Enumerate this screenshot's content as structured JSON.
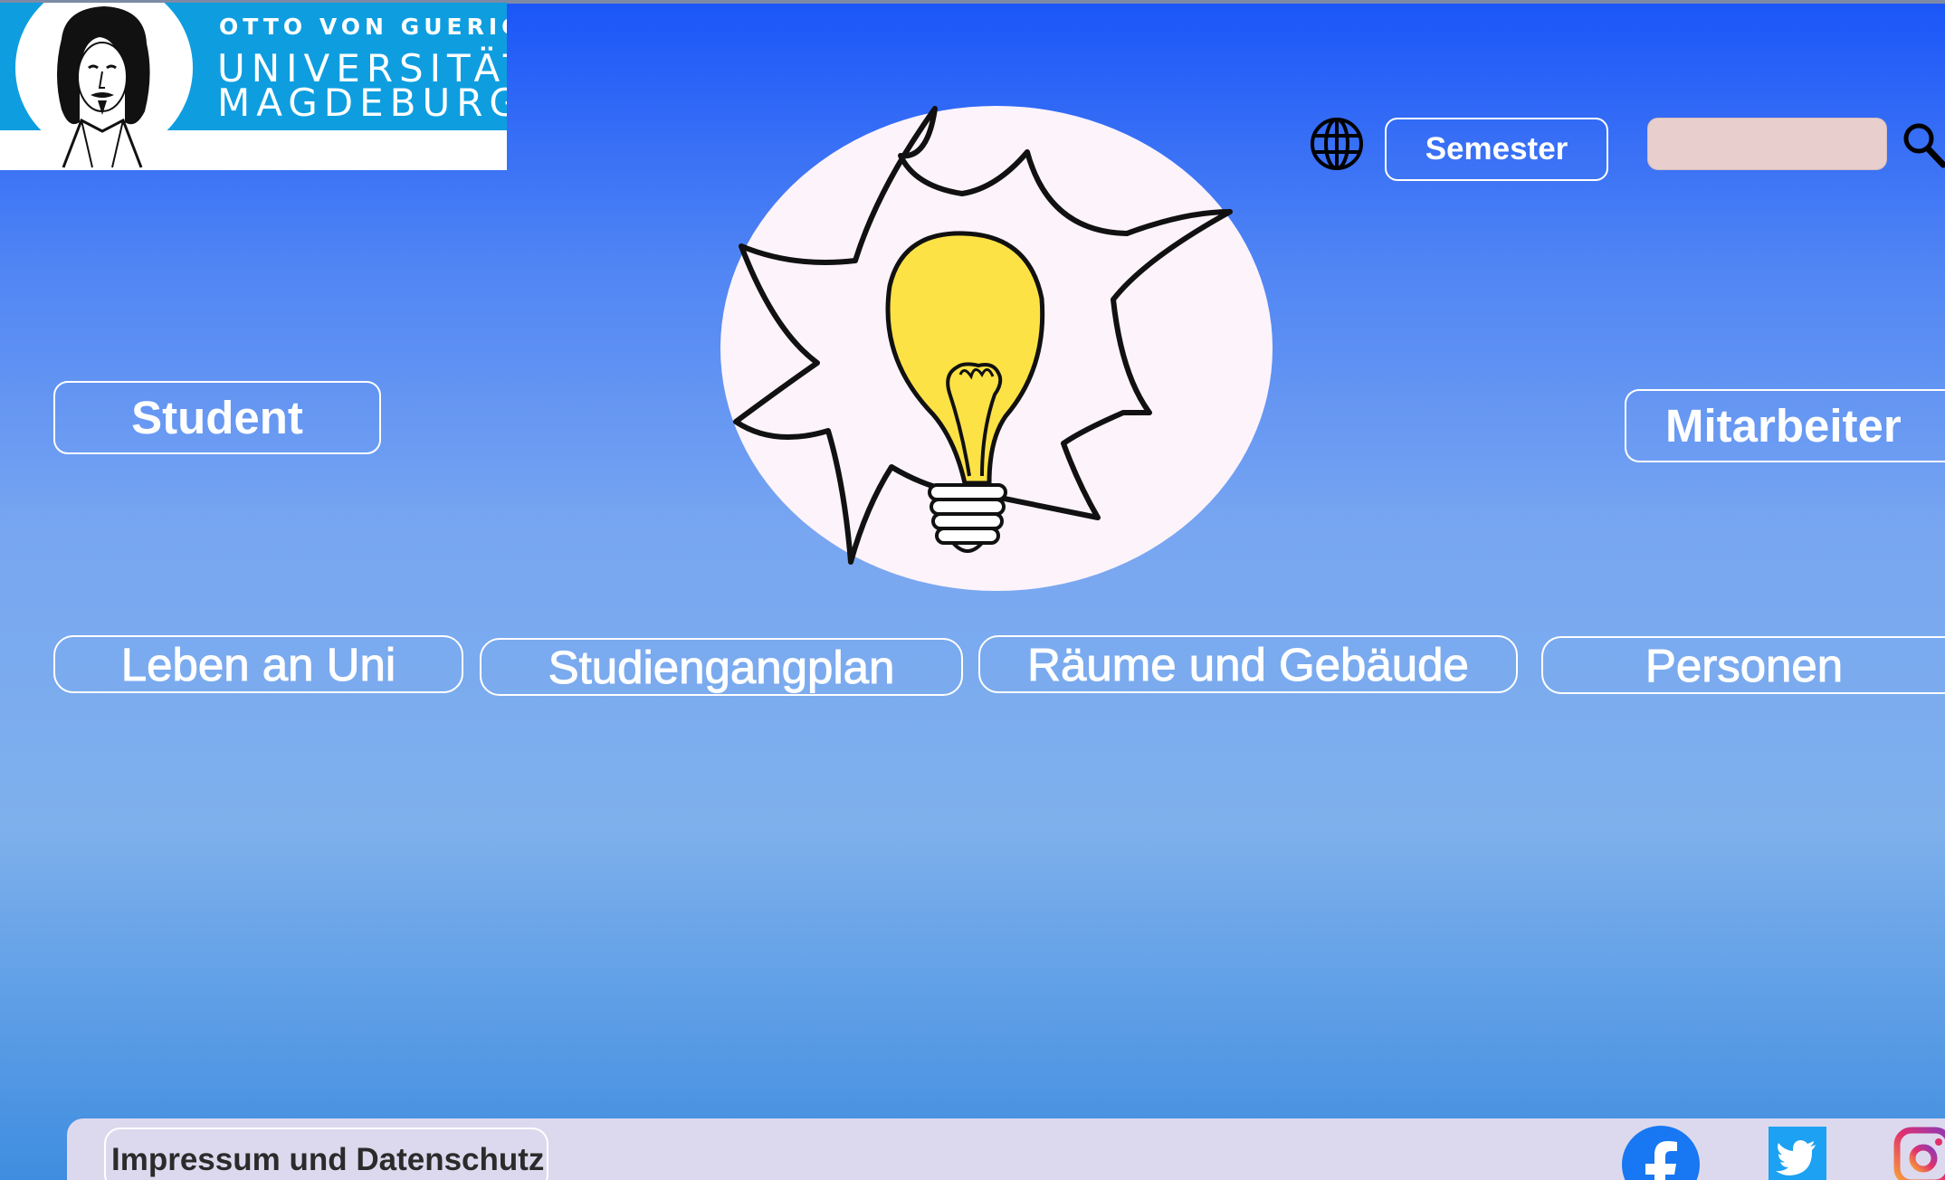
{
  "logo": {
    "line1": "OTTO VON GUERICKE",
    "line2": "UNIVERSITÄT",
    "line3": "MAGDEBURG"
  },
  "header": {
    "language_icon": "globe-icon",
    "semester_label": "Semester",
    "search_value": "",
    "search_icon": "search-icon"
  },
  "hero": {
    "image": "lightbulb-illustration"
  },
  "roles": {
    "student_label": "Student",
    "mitarbeiter_label": "Mitarbeiter"
  },
  "nav": {
    "items": [
      {
        "label": "Leben an Uni"
      },
      {
        "label": "Studiengangplan"
      },
      {
        "label": "Räume und Gebäude"
      },
      {
        "label": "Personen"
      }
    ]
  },
  "footer": {
    "impressum_label": "Impressum und Datenschutz",
    "social": [
      "facebook-icon",
      "twitter-icon",
      "instagram-icon"
    ]
  },
  "colors": {
    "logo_blue": "#0e9ee0",
    "bulb_yellow": "#fde245",
    "search_field": "#e8cfcd",
    "footer_bg": "#dcd9ee",
    "facebook": "#1877f2",
    "twitter": "#1da1f2"
  }
}
